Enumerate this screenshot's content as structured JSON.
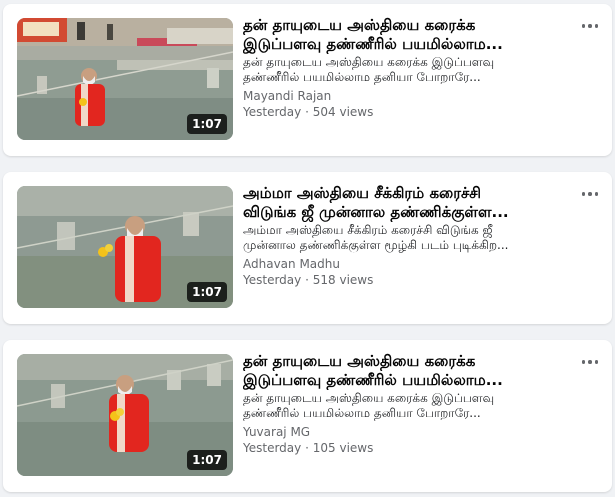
{
  "videos": [
    {
      "title_line1": "தன் தாயுடைய அஸ்தியை கரைக்க",
      "title_line2": "இடுப்பளவு தண்ணீரில் பயமில்லாம...",
      "desc_line1": "தன் தாயுடைய அஸ்தியை கரைக்க இடுப்பளவு",
      "desc_line2": "தண்ணீரில் பயமில்லாம தனியா போறாரே...",
      "author": "Mayandi Rajan",
      "posted": "Yesterday",
      "separator": "·",
      "views": "504 views",
      "duration": "1:07",
      "more_icon": "more-options-icon"
    },
    {
      "title_line1": "அம்மா அஸ்தியை சீக்கிரம் கரைச்சி",
      "title_line2": "விடுங்க ஜீ முன்னால தண்ணிக்குள்ள...",
      "desc_line1": "அம்மா அஸ்தியை சீக்கிரம் கரைச்சி விடுங்க ஜீ",
      "desc_line2": "முன்னால தண்ணிக்குள்ள மூழ்கி படம் புடிக்கிற...",
      "author": "Adhavan Madhu",
      "posted": "Yesterday",
      "separator": "·",
      "views": "518 views",
      "duration": "1:07",
      "more_icon": "more-options-icon"
    },
    {
      "title_line1": "தன் தாயுடைய அஸ்தியை கரைக்க",
      "title_line2": "இடுப்பளவு தண்ணீரில் பயமில்லாம...",
      "desc_line1": "தன் தாயுடைய அஸ்தியை கரைக்க இடுப்பளவு",
      "desc_line2": "தண்ணீரில் பயமில்லாம தனியா போறாரே...",
      "author": "Yuvaraj MG",
      "posted": "Yesterday",
      "separator": "·",
      "views": "105 views",
      "duration": "1:07",
      "more_icon": "more-options-icon"
    }
  ],
  "colors": {
    "background": "#f0f2f5",
    "card": "#ffffff",
    "title": "#050505",
    "secondary": "#65676b",
    "water": "#8a9a8f",
    "robe": "#e2261f"
  }
}
